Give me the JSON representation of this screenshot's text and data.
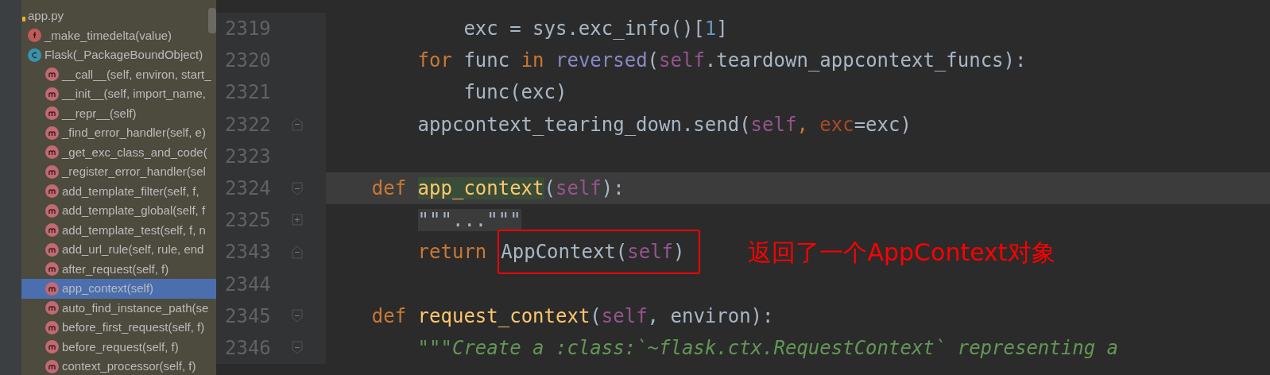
{
  "structure": {
    "file": "app.py",
    "items": [
      {
        "kind": "function",
        "label": "_make_timedelta(value)",
        "selected": false
      },
      {
        "kind": "class",
        "label": "Flask(_PackageBoundObject)",
        "selected": false,
        "children": [
          {
            "kind": "method",
            "label": "__call__(self, environ, start_",
            "selected": false
          },
          {
            "kind": "method",
            "label": "__init__(self, import_name,",
            "selected": false
          },
          {
            "kind": "method",
            "label": "__repr__(self)",
            "selected": false
          },
          {
            "kind": "method",
            "label": "_find_error_handler(self, e)",
            "selected": false
          },
          {
            "kind": "method",
            "label": "_get_exc_class_and_code(",
            "selected": false
          },
          {
            "kind": "method",
            "label": "_register_error_handler(sel",
            "selected": false
          },
          {
            "kind": "method",
            "label": "add_template_filter(self, f,",
            "selected": false
          },
          {
            "kind": "method",
            "label": "add_template_global(self, f",
            "selected": false
          },
          {
            "kind": "method",
            "label": "add_template_test(self, f, n",
            "selected": false
          },
          {
            "kind": "method",
            "label": "add_url_rule(self, rule, end",
            "selected": false
          },
          {
            "kind": "method",
            "label": "after_request(self, f)",
            "selected": false
          },
          {
            "kind": "method",
            "label": "app_context(self)",
            "selected": true
          },
          {
            "kind": "method",
            "label": "auto_find_instance_path(se",
            "selected": false
          },
          {
            "kind": "method",
            "label": "before_first_request(self, f)",
            "selected": false
          },
          {
            "kind": "method",
            "label": "before_request(self, f)",
            "selected": false
          },
          {
            "kind": "method",
            "label": "context_processor(self, f)",
            "selected": false
          }
        ]
      }
    ]
  },
  "editor": {
    "lines": [
      {
        "children": [
          {
            "children": [
              {
                "number": "2319",
                "tokens": [
                  {
                    "text": "exc = sys.exc_info()[",
                    "kind": "plain"
                  },
                  {
                    "text": "1",
                    "kind": "number"
                  },
                  {
                    "text": "]",
                    "kind": "plain"
                  }
                ]
              }
            ]
          },
          {
            "number": "2320",
            "tokens": [
              {
                "text": "for",
                "kind": "keyword"
              },
              {
                "text": " func ",
                "kind": "plain"
              },
              {
                "text": "in",
                "kind": "keyword"
              },
              {
                "text": " reversed",
                "kind": "builtin"
              },
              {
                "text": "(",
                "kind": "plain"
              },
              {
                "text": "self",
                "kind": "self"
              },
              {
                "text": ".teardown_appcontext_funcs):",
                "kind": "plain"
              }
            ],
            "children": [
              {
                "number": "2321",
                "tokens": [
                  {
                    "text": "func(exc)",
                    "kind": "plain"
                  }
                ]
              }
            ]
          },
          {
            "number": "2322",
            "fold_end": true,
            "tokens": [
              {
                "text": "appcontext_tearing_down.send(",
                "kind": "plain"
              },
              {
                "text": "self",
                "kind": "self"
              },
              {
                "text": ", ",
                "kind": "keyword"
              },
              {
                "text": "exc",
                "kind": "param"
              },
              {
                "text": "=exc)",
                "kind": "plain"
              }
            ]
          }
        ]
      },
      {
        "number": "2323"
      },
      {
        "number": "2324",
        "current": true,
        "fold_start": true,
        "tokens": [
          {
            "text": "def ",
            "kind": "keyword"
          },
          {
            "text": "app_context",
            "kind": "function_name",
            "highlighted": true
          },
          {
            "text": "(",
            "kind": "plain"
          },
          {
            "text": "self",
            "kind": "self"
          },
          {
            "text": "):",
            "kind": "plain"
          }
        ],
        "children": [
          {
            "number": "2325",
            "folded": true,
            "tokens": [
              {
                "text": "\"\"\"...\"\"\"",
                "kind": "folded"
              }
            ]
          },
          {
            "number": "2343",
            "fold_end": true,
            "tokens": [
              {
                "text": "return",
                "kind": "keyword"
              },
              {
                "kind": "box",
                "tokens": [
                  {
                    "text": "AppContext(",
                    "kind": "plain"
                  },
                  {
                    "text": "self",
                    "kind": "self"
                  },
                  {
                    "text": ")",
                    "kind": "plain"
                  }
                ]
              }
            ],
            "annotation": "返回了一个AppContext对象"
          }
        ]
      },
      {
        "number": "2344"
      },
      {
        "number": "2345",
        "fold_start": true,
        "tokens": [
          {
            "text": "def",
            "kind": "keyword"
          },
          {
            "text": " request_context",
            "kind": "function_name"
          },
          {
            "text": "(",
            "kind": "plain"
          },
          {
            "text": "self",
            "kind": "self"
          },
          {
            "text": ", environ):",
            "kind": "plain"
          }
        ],
        "children": [
          {
            "number": "2346",
            "fold_start": true,
            "tokens": [
              {
                "text": "\"\"\"Create a :class:`~flask.ctx.RequestContext` representing a",
                "kind": "docstring"
              }
            ]
          }
        ]
      }
    ]
  }
}
